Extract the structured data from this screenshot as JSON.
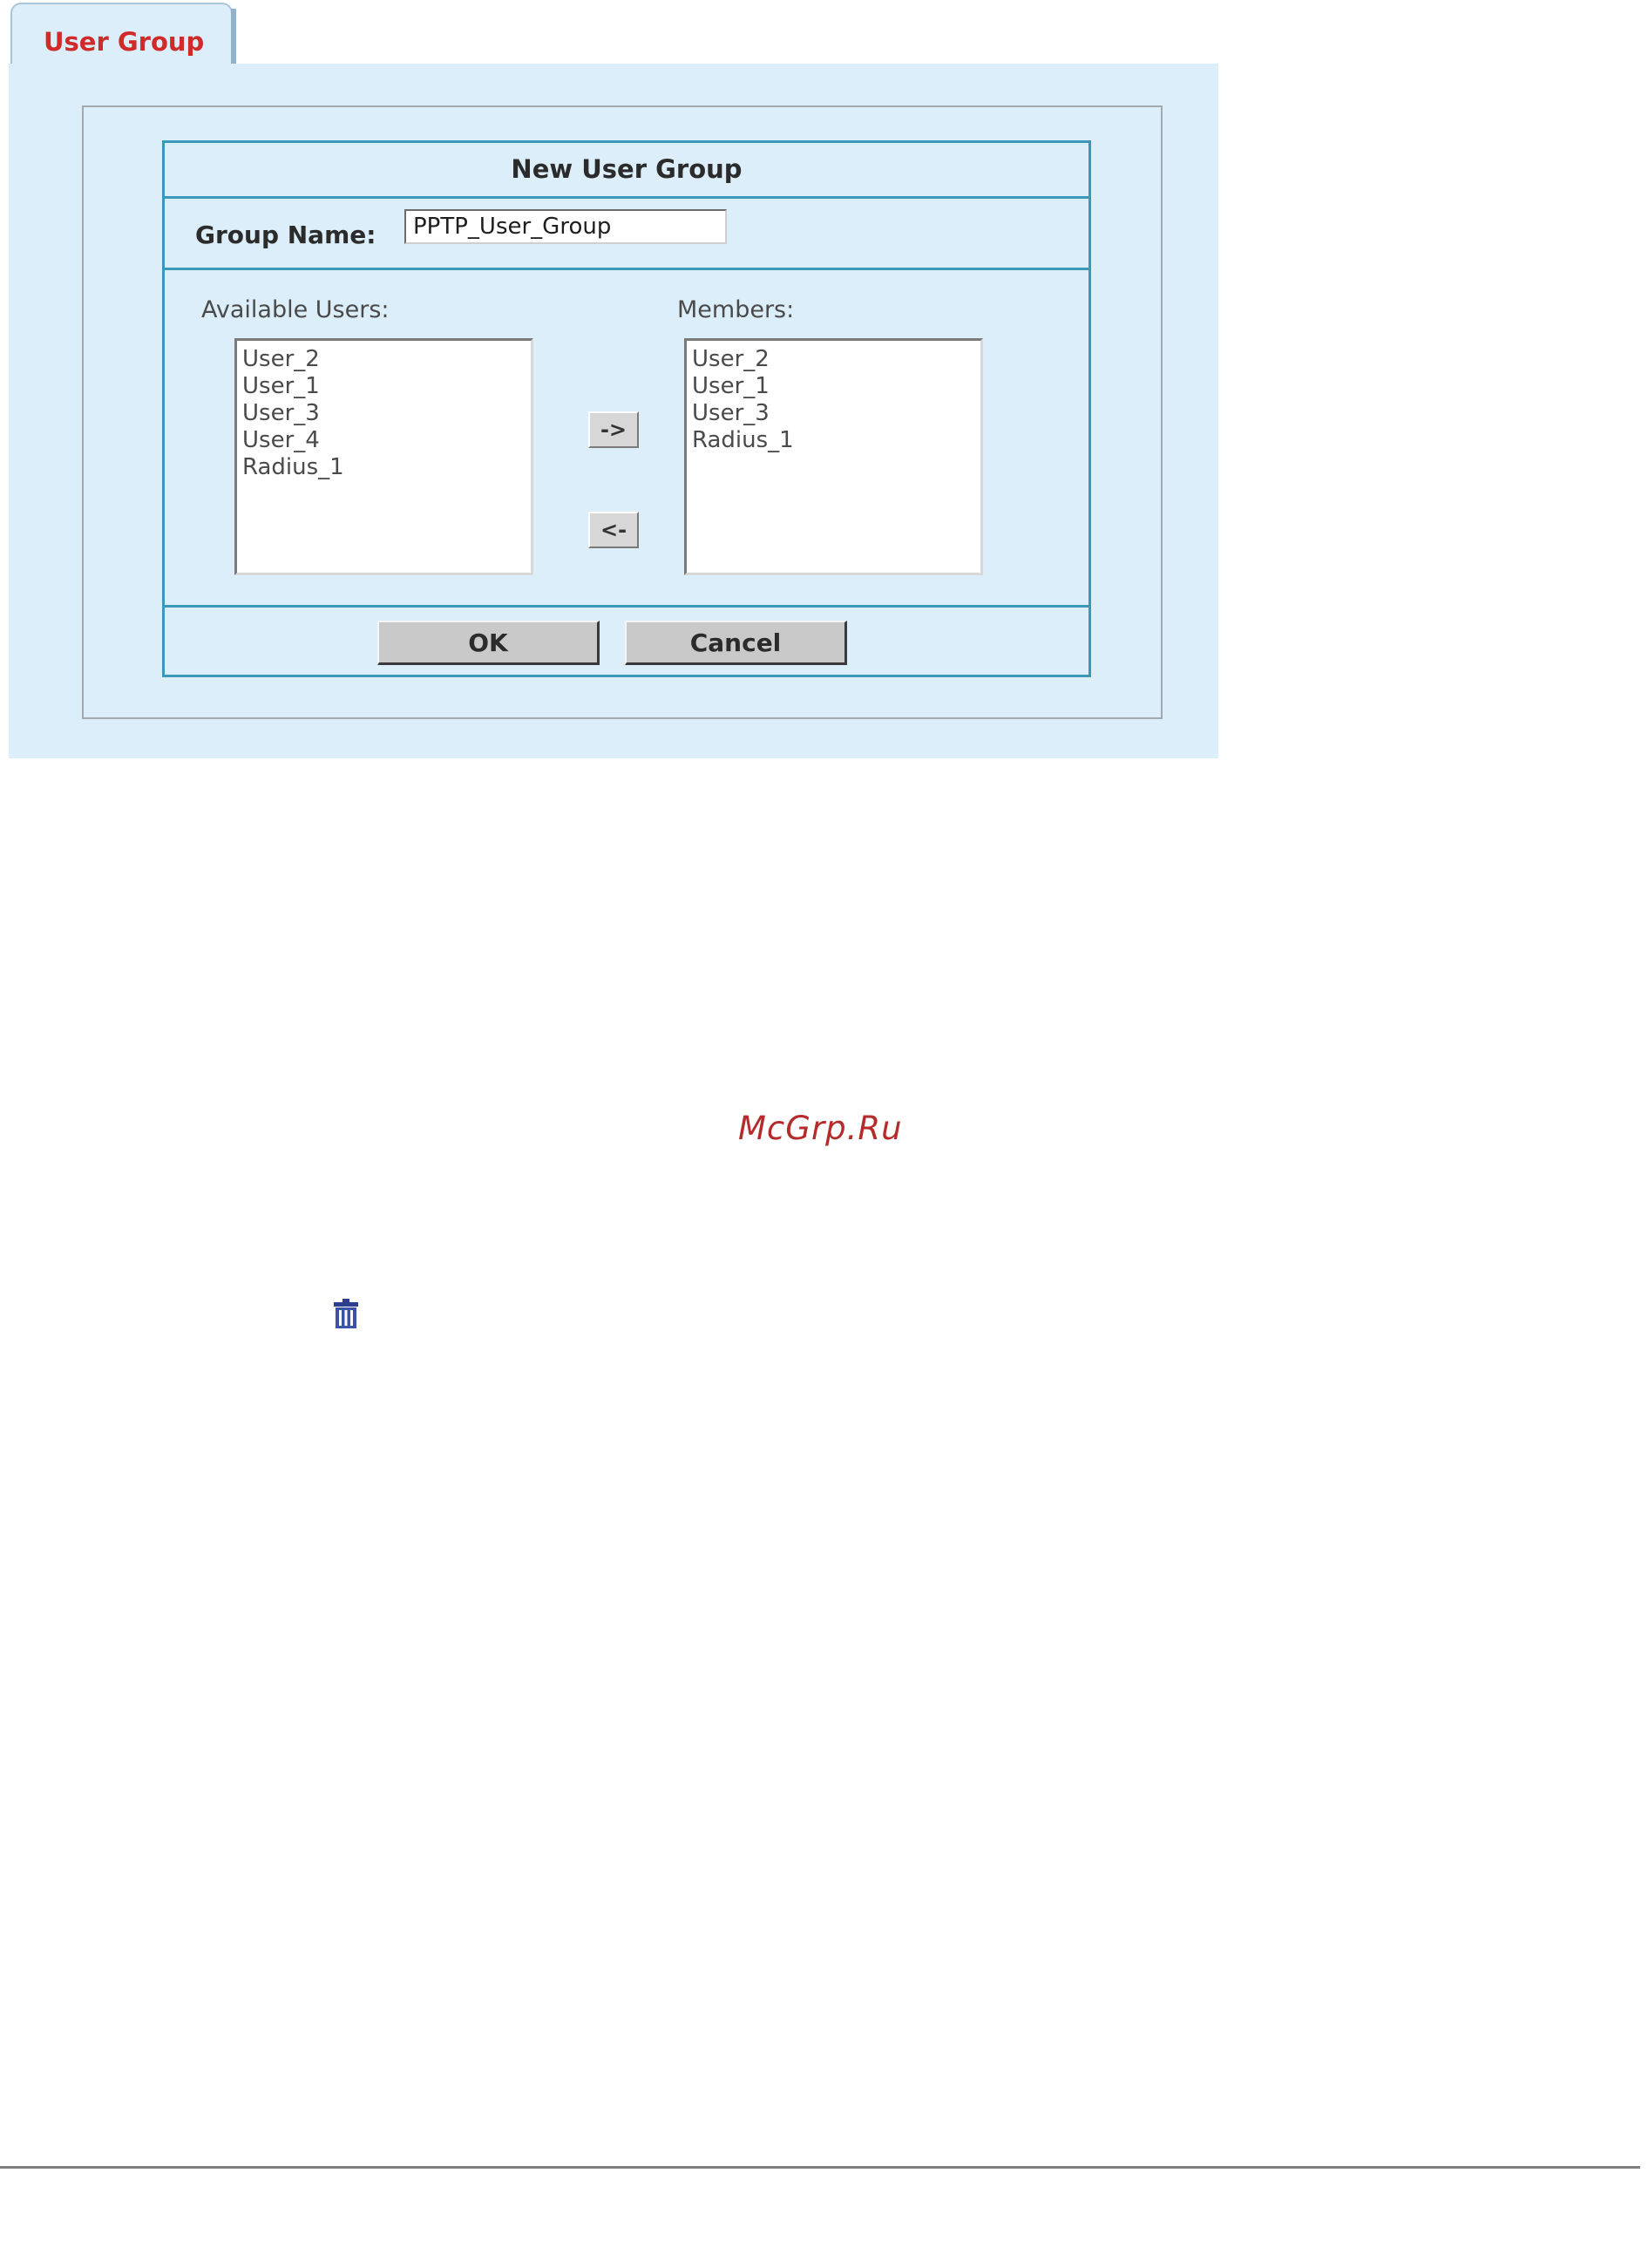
{
  "tab": {
    "label": "User Group"
  },
  "dialog": {
    "title": "New User Group",
    "group_name_label": "Group Name:",
    "group_name_value": "PPTP_User_Group",
    "available_label": "Available Users:",
    "members_label": "Members:",
    "available_users": [
      "User_2",
      "User_1",
      "User_3",
      "User_4",
      "Radius_1"
    ],
    "members": [
      "User_2",
      "User_1",
      "User_3",
      "Radius_1"
    ],
    "add_button": "->",
    "remove_button": "<-",
    "ok_button": "OK",
    "cancel_button": "Cancel"
  },
  "watermark": "McGrp.Ru",
  "icons": {
    "trash": "trash-icon"
  },
  "colors": {
    "panel_bg": "#dbeef9",
    "dialog_border": "#3b98b8",
    "tab_text": "#d02a2a",
    "watermark": "#b52a2a"
  }
}
